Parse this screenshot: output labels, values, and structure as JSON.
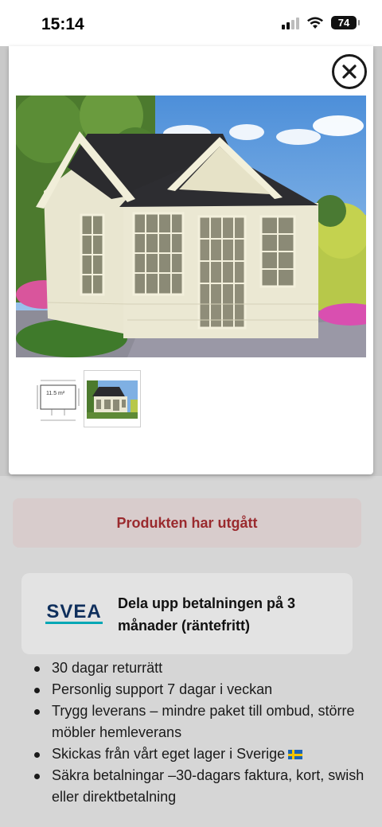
{
  "status_bar": {
    "time": "15:14",
    "battery": "74"
  },
  "modal": {
    "close_label": "Close",
    "main_image_alt": "Product image",
    "thumbnails": [
      {
        "name": "floor-plan",
        "area_label": "11.5 m²"
      },
      {
        "name": "product-photo"
      }
    ]
  },
  "notice": {
    "text": "Produkten har utgått"
  },
  "svea": {
    "logo_text": "SVEA",
    "text": "Dela upp betalningen på 3 månader (räntefritt)"
  },
  "benefits": [
    {
      "text": "30 dagar returrätt"
    },
    {
      "text": "Personlig support 7 dagar i veckan"
    },
    {
      "text": "Trygg leverans – mindre paket till ombud, större möbler hemleverans"
    },
    {
      "text": "Skickas från vårt eget lager i Sverige"
    },
    {
      "text": "Säkra betalningar –30-dagars faktura, kort, swish eller direktbetalning"
    }
  ],
  "colors": {
    "notice_text": "#9a2a2e",
    "svea_blue": "#0f2f5c",
    "svea_teal": "#00a7b5"
  }
}
